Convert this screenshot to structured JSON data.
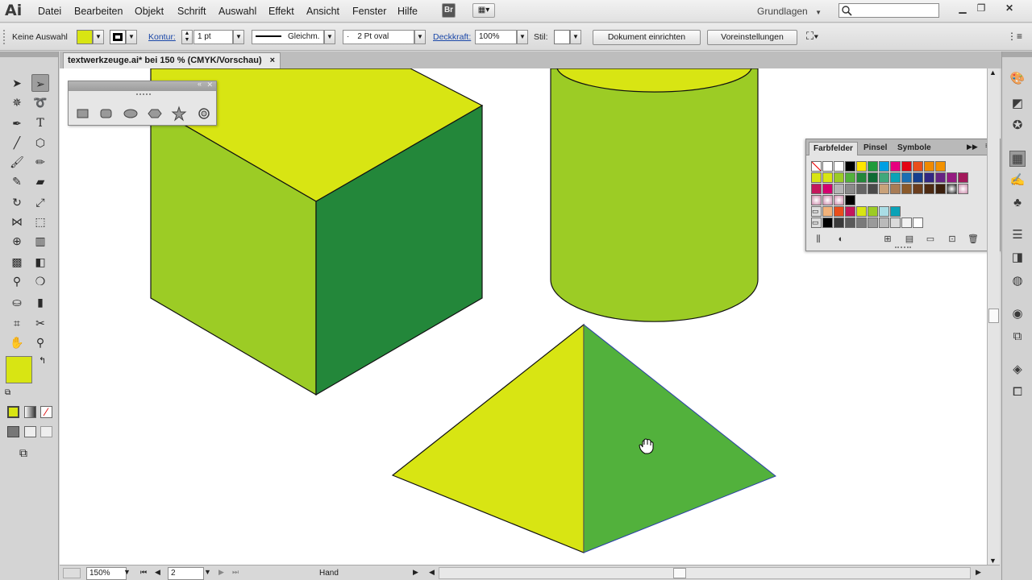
{
  "app": {
    "logo": "Ai"
  },
  "menu": {
    "items": [
      "Datei",
      "Bearbeiten",
      "Objekt",
      "Schrift",
      "Auswahl",
      "Effekt",
      "Ansicht",
      "Fenster",
      "Hilfe"
    ],
    "bridge_button": "Br",
    "workspace": "Grundlagen",
    "search_placeholder": ""
  },
  "control_bar": {
    "selection": "Keine Auswahl",
    "stroke_label": "Kontur:",
    "stroke_weight": "1 pt",
    "stroke_profile": "Gleichm.",
    "brush": "2 Pt oval",
    "opacity_label": "Deckkraft:",
    "opacity": "100%",
    "style_label": "Stil:",
    "document_setup": "Dokument einrichten",
    "preferences": "Voreinstellungen",
    "fill_color": "#d8e513"
  },
  "document": {
    "tab_title": "textwerkzeuge.ai* bei 150 % (CMYK/Vorschau)",
    "close_symbol": "×"
  },
  "status_bar": {
    "zoom": "150%",
    "artboard": "2",
    "current_tool": "Hand"
  },
  "swatches_panel": {
    "tabs": [
      "Farbfelder",
      "Pinsel",
      "Symbole"
    ],
    "active_tab": "Farbfelder"
  },
  "colors": {
    "yellow": "#d8e513",
    "yellow_green": "#9ccc25",
    "dark_green": "#23873a",
    "green": "#52b13c"
  }
}
